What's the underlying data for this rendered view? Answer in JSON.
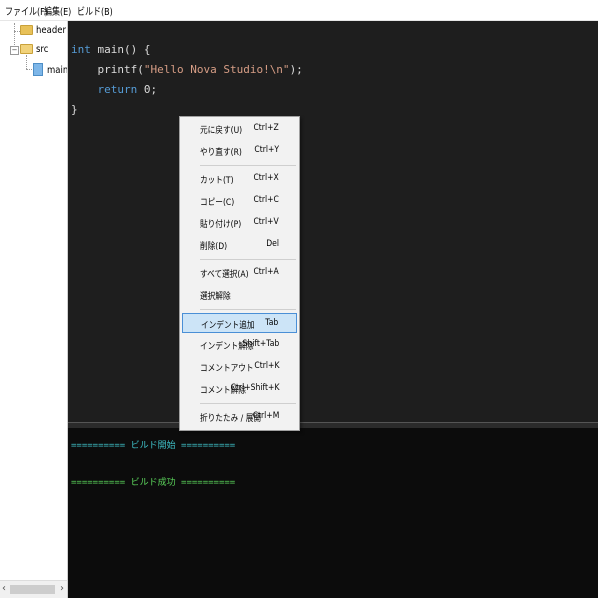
{
  "menubar": {
    "items": [
      "ファイル(F)",
      "編集(E)",
      "ビルド(B)"
    ]
  },
  "tree": {
    "items": [
      {
        "label": "header",
        "icon": "folder-icon"
      },
      {
        "label": "src",
        "icon": "folder-open-icon"
      },
      {
        "label": "main.c",
        "icon": "file-icon"
      }
    ],
    "scroll_left": "‹",
    "scroll_right": "›"
  },
  "editor": {
    "lines": [
      {
        "parts": [
          {
            "t": "int",
            "k": "kw"
          },
          {
            "t": " main() {",
            "k": "fn"
          }
        ]
      },
      {
        "parts": [
          {
            "t": "    printf(",
            "k": "fn"
          },
          {
            "t": "\"Hello Nova Studio!\\n\"",
            "k": "str"
          },
          {
            "t": ");",
            "k": "fn"
          }
        ]
      },
      {
        "parts": [
          {
            "t": "    ",
            "k": "fn"
          },
          {
            "t": "return",
            "k": "kw"
          },
          {
            "t": " 0;",
            "k": "fn"
          }
        ]
      },
      {
        "parts": [
          {
            "t": "}",
            "k": "fn"
          }
        ]
      }
    ]
  },
  "output": {
    "build_start": "========== ビルド開始 ==========",
    "build_success": "========== ビルド成功 =========="
  },
  "context_menu": {
    "groups": [
      [
        {
          "label": "元に戻す(U)",
          "shortcut": "Ctrl+Z"
        },
        {
          "label": "やり直す(R)",
          "shortcut": "Ctrl+Y"
        }
      ],
      [
        {
          "label": "カット(T)",
          "shortcut": "Ctrl+X"
        },
        {
          "label": "コピー(C)",
          "shortcut": "Ctrl+C"
        },
        {
          "label": "貼り付け(P)",
          "shortcut": "Ctrl+V"
        },
        {
          "label": "削除(D)",
          "shortcut": "Del"
        }
      ],
      [
        {
          "label": "すべて選択(A)",
          "shortcut": "Ctrl+A"
        },
        {
          "label": "選択解除",
          "shortcut": ""
        }
      ],
      [
        {
          "label": "インデント追加",
          "shortcut": "Tab",
          "highlighted": true
        },
        {
          "label": "インデント解除",
          "shortcut": "Shift+Tab"
        },
        {
          "label": "コメントアウト",
          "shortcut": "Ctrl+K"
        },
        {
          "label": "コメント解除",
          "shortcut": "Ctrl+Shift+K"
        }
      ],
      [
        {
          "label": "折りたたみ / 展開",
          "shortcut": "Ctrl+M"
        }
      ]
    ]
  },
  "colors": {
    "editor_bg": "#1e1e1e",
    "output_bg": "#0c0c0c",
    "keyword": "#569cd6",
    "string": "#d69d85",
    "build_start": "#3fc1c9",
    "build_success": "#5cd65c",
    "menu_highlight": "#cce4f7"
  }
}
